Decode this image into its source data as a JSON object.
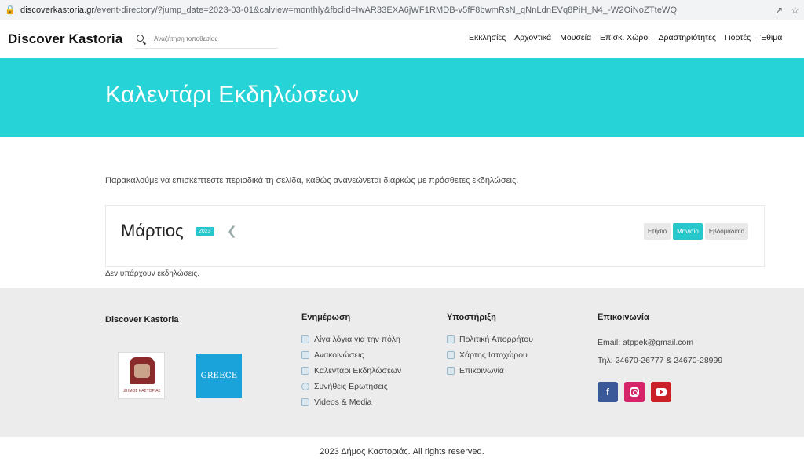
{
  "browser": {
    "url_host": "discoverkastoria.gr",
    "url_path": "/event-directory/?jump_date=2023-03-01&calview=monthly&fbclid=IwAR33EXA6jWF1RMDB-v5fF8bwmRsN_qNnLdnEVq8PiH_N4_-W2OiNoZTteWQ"
  },
  "header": {
    "brand": "Discover Kastoria",
    "search_placeholder": "Αναζήτηση τοποθεσίας",
    "nav": [
      "Εκκλησίες",
      "Αρχοντικά",
      "Μουσεία",
      "Επισκ. Χώροι",
      "Δραστηριότητες",
      "Γιορτές – Έθιμα"
    ]
  },
  "hero": {
    "title": "Καλεντάρι Εκδηλώσεων"
  },
  "main": {
    "notice": "Παρακαλούμε να επισκέπτεστε περιοδικά τη σελίδα, καθώς ανανεώνεται διαρκώς με πρόσθετες εκδηλώσεις.",
    "month": "Μάρτιος",
    "year": "2023",
    "views": [
      "Ετήσιο",
      "Μηνιαίο",
      "Εβδομαδιαίο"
    ],
    "active_view": "Μηνιαίο",
    "no_events": "Δεν υπάρχουν εκδηλώσεις."
  },
  "footer": {
    "brand": "Discover Kastoria",
    "kastoria_logo_caption": "ΔΗΜΟΣ ΚΑΣΤΟΡΙΑΣ",
    "greece_logo_text": "GREECE",
    "info_title": "Ενημέρωση",
    "info_items": [
      "Λίγα λόγια για την πόλη",
      "Ανακοινώσεις",
      "Καλεντάρι Εκδηλώσεων",
      "Συνήθεις Ερωτήσεις",
      "Videos & Media"
    ],
    "support_title": "Υποστήριξη",
    "support_items": [
      "Πολιτική Απορρήτου",
      "Χάρτης Ιστοχώρου",
      "Επικοινωνία"
    ],
    "contact_title": "Επικοινωνία",
    "email": "Email: atppek@gmail.com",
    "phone": "Τηλ: 24670-26777 & 24670-28999",
    "copyright": "2023 Δήμος Καστοριάς. All rights reserved."
  },
  "colors": {
    "accent": "#26d3d6",
    "facebook": "#3b5998",
    "instagram": "#d6246b",
    "youtube": "#cc2027"
  }
}
